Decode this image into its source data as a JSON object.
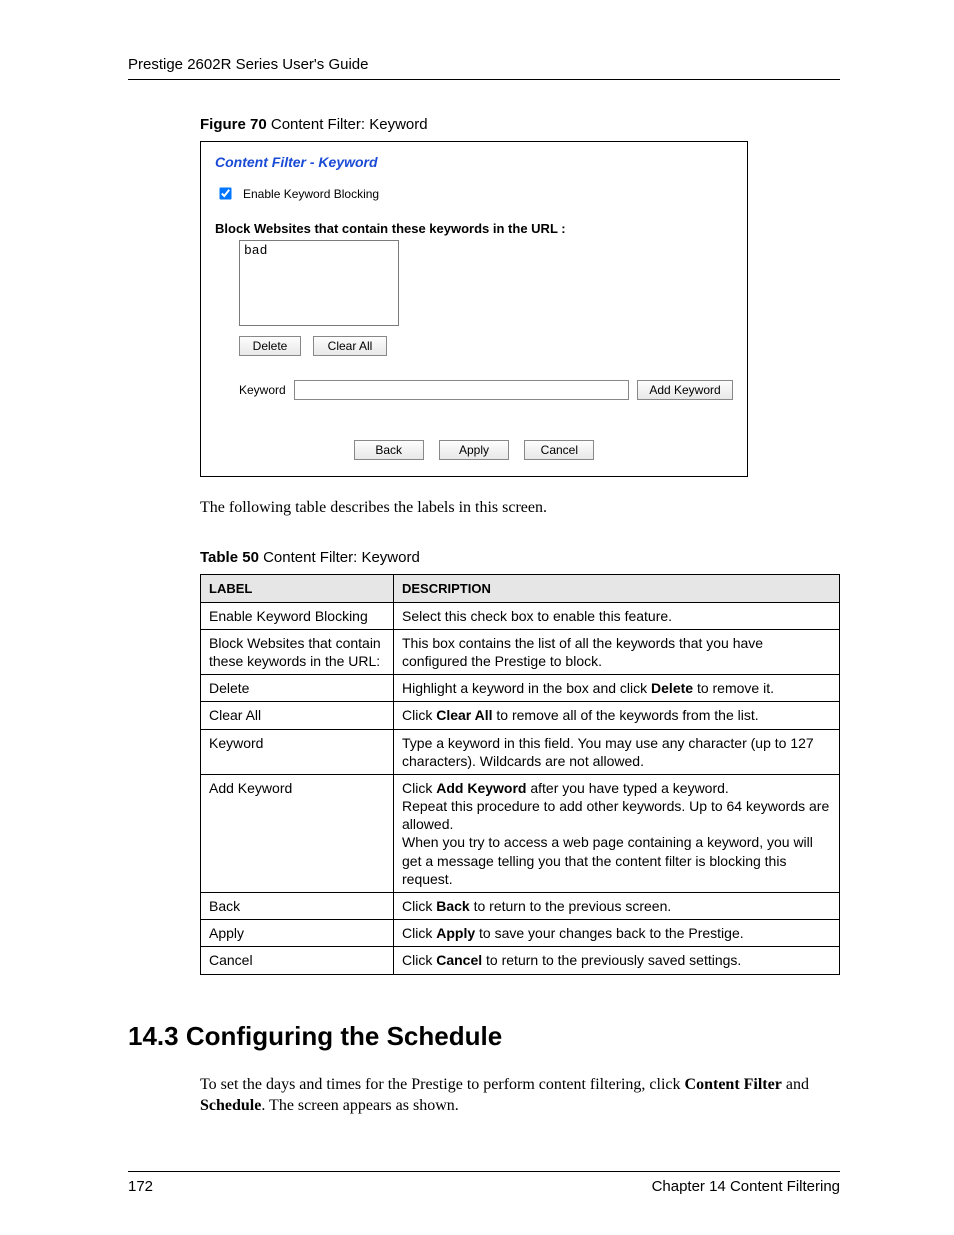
{
  "header": {
    "title": "Prestige 2602R Series User's Guide"
  },
  "figure": {
    "caption_bold": "Figure 70",
    "caption_rest": "   Content Filter: Keyword",
    "panel_title": "Content Filter - Keyword",
    "enable_label": "Enable Keyword Blocking",
    "block_label": "Block Websites that contain these keywords in the URL :",
    "keyword_list": "bad",
    "delete_btn": "Delete",
    "clearall_btn": "Clear All",
    "keyword_label": "Keyword",
    "addkeyword_btn": "Add Keyword",
    "back_btn": "Back",
    "apply_btn": "Apply",
    "cancel_btn": "Cancel"
  },
  "intro_text": "The following table describes the labels in this screen.",
  "table": {
    "caption_bold": "Table 50",
    "caption_rest": "   Content Filter: Keyword",
    "head_label": "LABEL",
    "head_desc": "DESCRIPTION",
    "rows": [
      {
        "label": "Enable Keyword Blocking",
        "desc_html": "Select this check box to enable this feature."
      },
      {
        "label": "Block Websites that contain these keywords in the URL:",
        "desc_html": "This box contains the list of all the keywords that you have configured the Prestige to block."
      },
      {
        "label": "Delete",
        "desc_html": "Highlight a keyword in the box and click <b>Delete</b> to remove it."
      },
      {
        "label": "Clear All",
        "desc_html": "Click <b>Clear All</b> to remove all of the keywords from the list."
      },
      {
        "label": "Keyword",
        "desc_html": "Type a keyword in this field. You may use any character (up to 127 characters). Wildcards are not allowed."
      },
      {
        "label": "Add Keyword",
        "desc_html": "Click <b>Add Keyword</b> after you have typed a keyword.<br>Repeat this procedure to add other keywords. Up to 64 keywords are allowed.<br>When you try to access a web page containing a keyword, you will get a message telling you that the content filter is blocking this request."
      },
      {
        "label": "Back",
        "desc_html": "Click <b>Back</b> to return to the previous screen."
      },
      {
        "label": "Apply",
        "desc_html": "Click <b>Apply</b> to save your changes back to the Prestige."
      },
      {
        "label": "Cancel",
        "desc_html": "Click <b>Cancel</b> to return to the previously saved settings."
      }
    ]
  },
  "section": {
    "heading": "14.3  Configuring the Schedule",
    "body_html": "To set the days and times for the Prestige to perform content filtering, click <b>Content Filter</b> and <b>Schedule</b>. The screen appears as shown."
  },
  "footer": {
    "page": "172",
    "chapter": "Chapter 14 Content Filtering"
  }
}
